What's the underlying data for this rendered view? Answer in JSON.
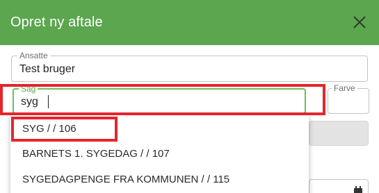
{
  "dialog": {
    "title": "Opret ny aftale",
    "close_icon": "close-icon"
  },
  "form": {
    "ansatte": {
      "label": "Ansatte",
      "value": "Test bruger"
    },
    "sag": {
      "label": "Sag",
      "value": "syg"
    },
    "farve": {
      "label": "Farve"
    }
  },
  "dropdown": {
    "options": [
      {
        "label": "SYG / / 106"
      },
      {
        "label": "BARNETS 1. SYGEDAG / / 107"
      },
      {
        "label": "SYGEDAGPENGE FRA KOMMUNEN / / 115"
      }
    ]
  },
  "colors": {
    "header": "#5ba64f",
    "focus": "#6cbf5b",
    "highlight": "#e3262c"
  }
}
